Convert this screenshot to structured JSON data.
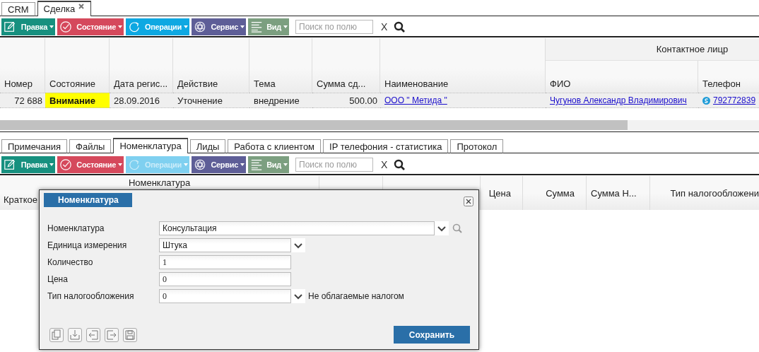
{
  "tabs": [
    {
      "label": "CRM",
      "selected": false,
      "closable": false
    },
    {
      "label": "Сделка",
      "selected": true,
      "closable": true
    }
  ],
  "toolbar": {
    "buttons": [
      {
        "kind": "edit",
        "label": "Правка",
        "color": "#17907f",
        "disabled": false
      },
      {
        "kind": "state",
        "label": "Состояние",
        "color": "#d5495c",
        "disabled": false
      },
      {
        "kind": "operations",
        "label": "Операции",
        "color": "#0ea8e2",
        "disabled": false
      },
      {
        "kind": "service",
        "label": "Сервис",
        "color": "#5e5e97",
        "disabled": false
      },
      {
        "kind": "view",
        "label": "Вид",
        "color": "#7c9f80",
        "disabled": false
      }
    ],
    "search": {
      "placeholder": "Поиск по полю"
    },
    "clear": "X"
  },
  "deals_table": {
    "column_group": "Контактное лицр",
    "columns": [
      "Номер",
      "Состояние",
      "Дата регис...",
      "Действие",
      "Тема",
      "Сумма сд...",
      "Наименование",
      "ФИО",
      "Телефон"
    ],
    "rows": [
      {
        "cells": [
          {
            "kind": "number",
            "text": "72 688"
          },
          {
            "kind": "status",
            "text": "Внимание"
          },
          {
            "kind": "text",
            "text": "28.09.2016"
          },
          {
            "kind": "text",
            "text": "Уточнение"
          },
          {
            "kind": "text",
            "text": "внедрение"
          },
          {
            "kind": "number",
            "text": "500.00"
          },
          {
            "kind": "link",
            "text": "ООО \" Метида \""
          },
          {
            "kind": "link",
            "text": "Чугунов Александр Владимирович"
          },
          {
            "kind": "phone",
            "text": "792772839"
          }
        ]
      }
    ]
  },
  "detail_tabs": [
    {
      "label": "Примечания",
      "selected": false
    },
    {
      "label": "Файлы",
      "selected": false
    },
    {
      "label": "Номенклатура",
      "selected": true
    },
    {
      "label": "Лиды",
      "selected": false
    },
    {
      "label": "Работа с клиентом",
      "selected": false
    },
    {
      "label": "IP телефония - статистика",
      "selected": false
    },
    {
      "label": "Протокол",
      "selected": false
    }
  ],
  "detail_toolbar": {
    "buttons": [
      {
        "kind": "edit",
        "label": "Правка",
        "color": "#17907f",
        "disabled": false
      },
      {
        "kind": "state",
        "label": "Состояние",
        "color": "#d5495c",
        "disabled": false
      },
      {
        "kind": "operations",
        "label": "Операции",
        "color": "#7fd0f0",
        "disabled": true
      },
      {
        "kind": "service",
        "label": "Сервис",
        "color": "#5e5e97",
        "disabled": false
      },
      {
        "kind": "view",
        "label": "Вид",
        "color": "#7c9f80",
        "disabled": false
      }
    ],
    "search": {
      "placeholder": "Поиск по полю"
    },
    "clear": "X"
  },
  "items_table": {
    "column_group": "Номенклатура",
    "columns": [
      "Краткое",
      "Цена",
      "Сумма",
      "Сумма Н...",
      "Тип налогообложени"
    ]
  },
  "dialog": {
    "title": "Номенклатура",
    "fields": [
      {
        "kind": "lookup",
        "label": "Номенклатура",
        "value": "Консультация"
      },
      {
        "kind": "select",
        "label": "Единица измерения",
        "value": "Штука"
      },
      {
        "kind": "input",
        "label": "Количество",
        "value": "1"
      },
      {
        "kind": "input",
        "label": "Цена",
        "value": "0"
      },
      {
        "kind": "select",
        "label": "Тип налогообложения",
        "value": "0",
        "note": "Не облагаемые налогом"
      }
    ],
    "save": "Сохранить"
  }
}
